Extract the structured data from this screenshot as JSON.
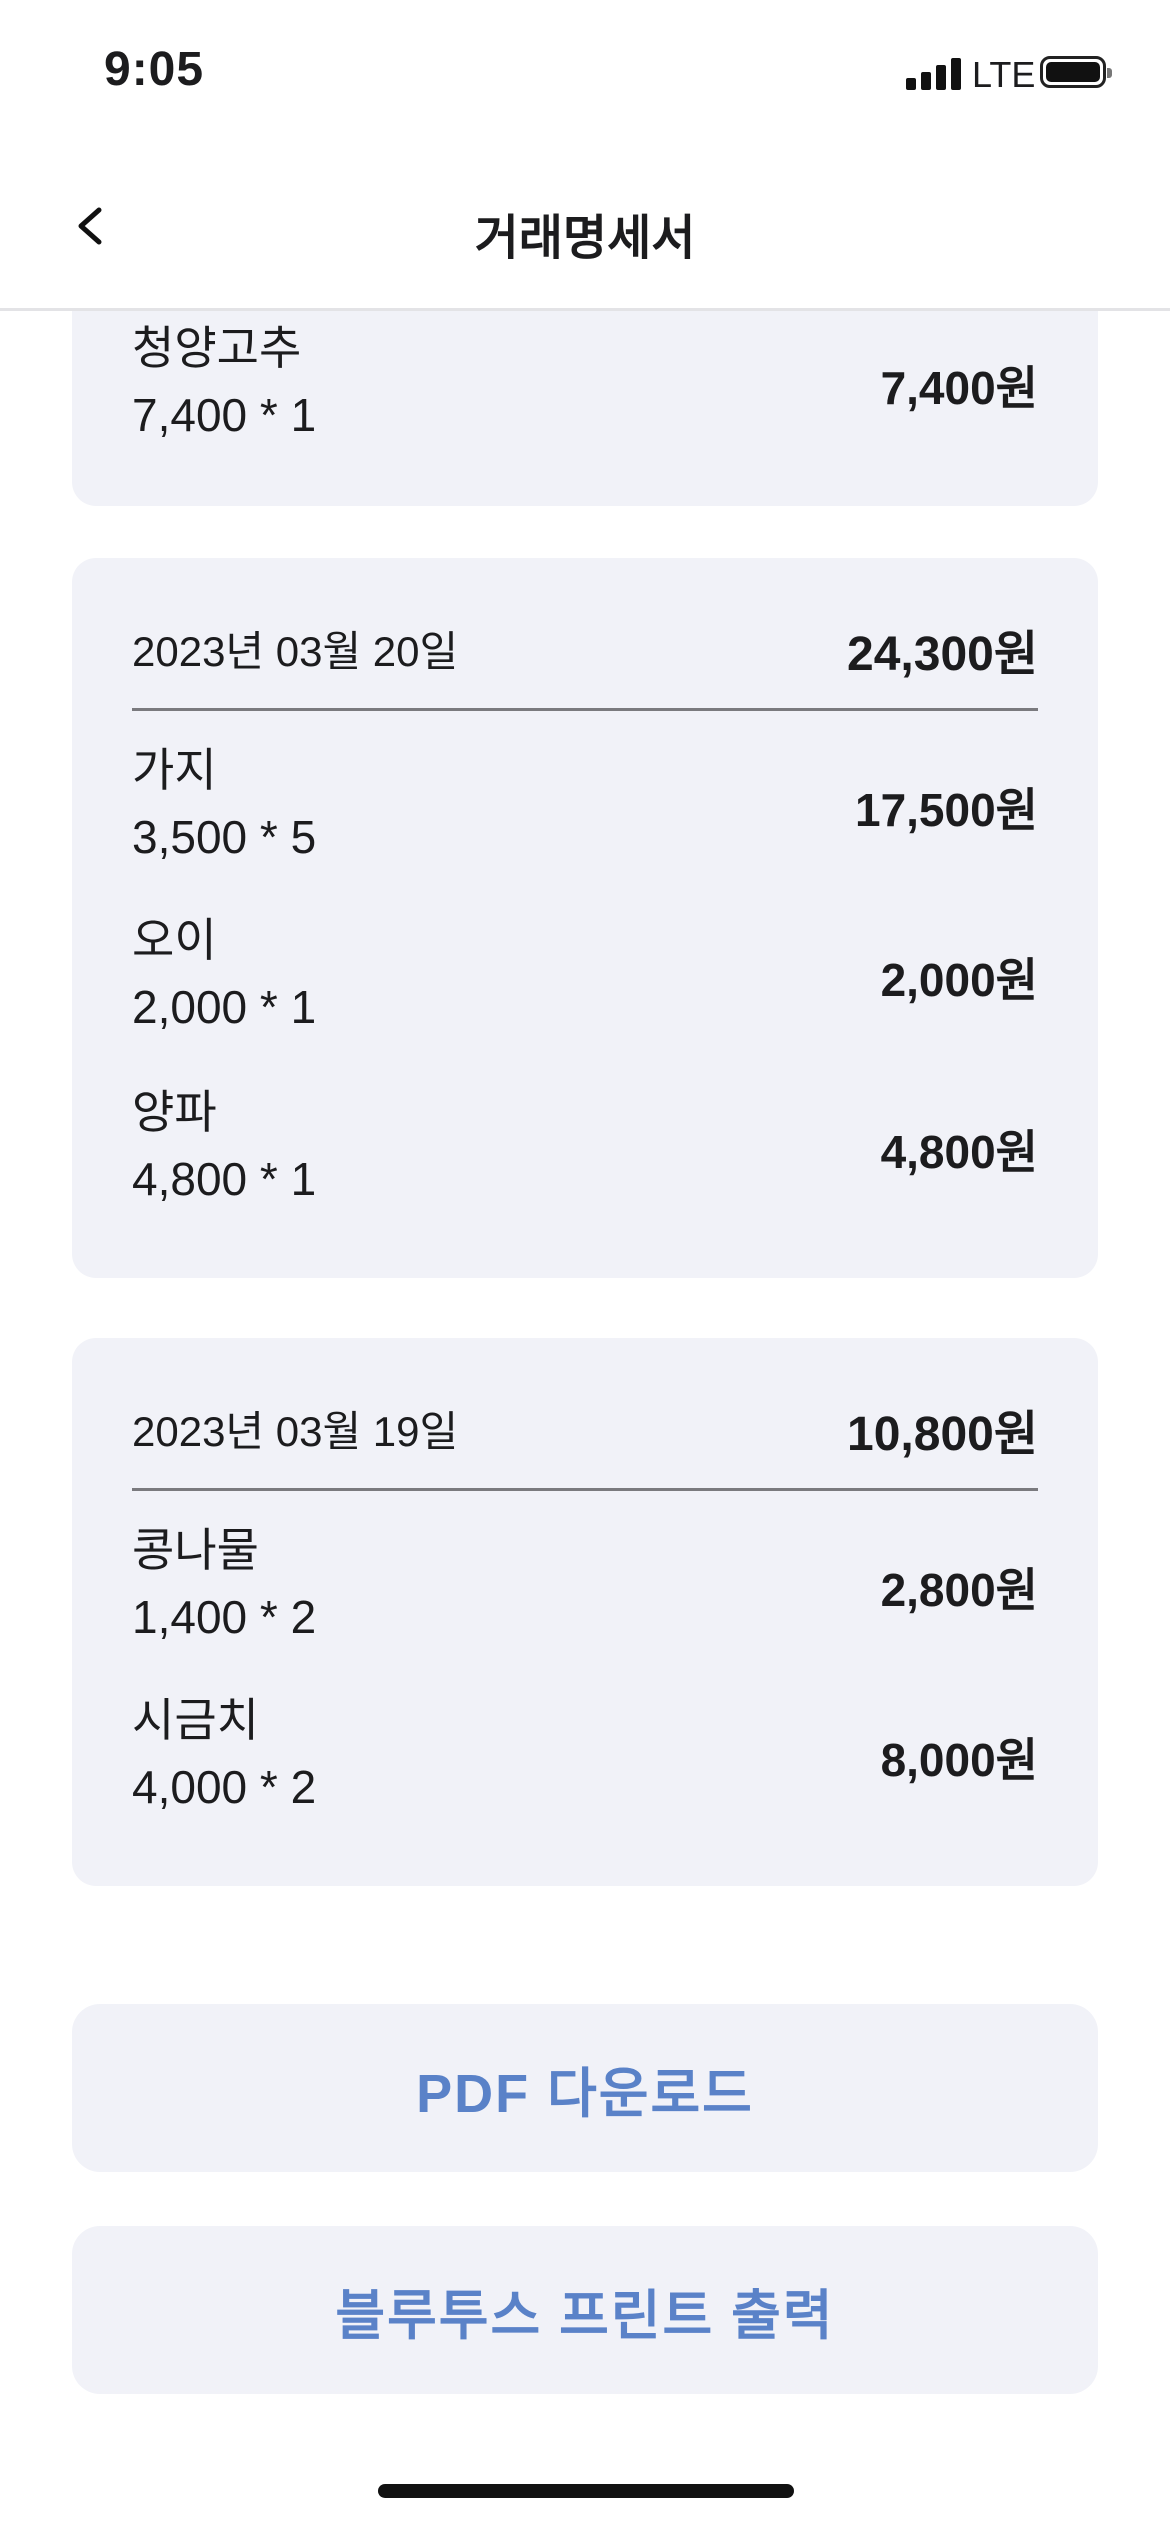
{
  "status_bar": {
    "time": "9:05",
    "network": "LTE"
  },
  "nav": {
    "title": "거래명세서",
    "back_icon": "chevron-left-icon"
  },
  "partial_item": {
    "name": "청양고추",
    "qty": "7,400 * 1",
    "amount": "7,400원"
  },
  "cards": [
    {
      "date": "2023년 03월 20일",
      "total": "24,300원",
      "items": [
        {
          "name": "가지",
          "qty": "3,500 * 5",
          "amount": "17,500원"
        },
        {
          "name": "오이",
          "qty": "2,000 * 1",
          "amount": "2,000원"
        },
        {
          "name": "양파",
          "qty": "4,800 * 1",
          "amount": "4,800원"
        }
      ]
    },
    {
      "date": "2023년 03월 19일",
      "total": "10,800원",
      "items": [
        {
          "name": "콩나물",
          "qty": "1,400 * 2",
          "amount": "2,800원"
        },
        {
          "name": "시금치",
          "qty": "4,000 * 2",
          "amount": "8,000원"
        }
      ]
    }
  ],
  "actions": {
    "pdf_download": "PDF 다운로드",
    "bluetooth_print": "블루투스 프린트 출력"
  },
  "colors": {
    "card_bg": "#f1f2f8",
    "action_text": "#5a82c8"
  }
}
